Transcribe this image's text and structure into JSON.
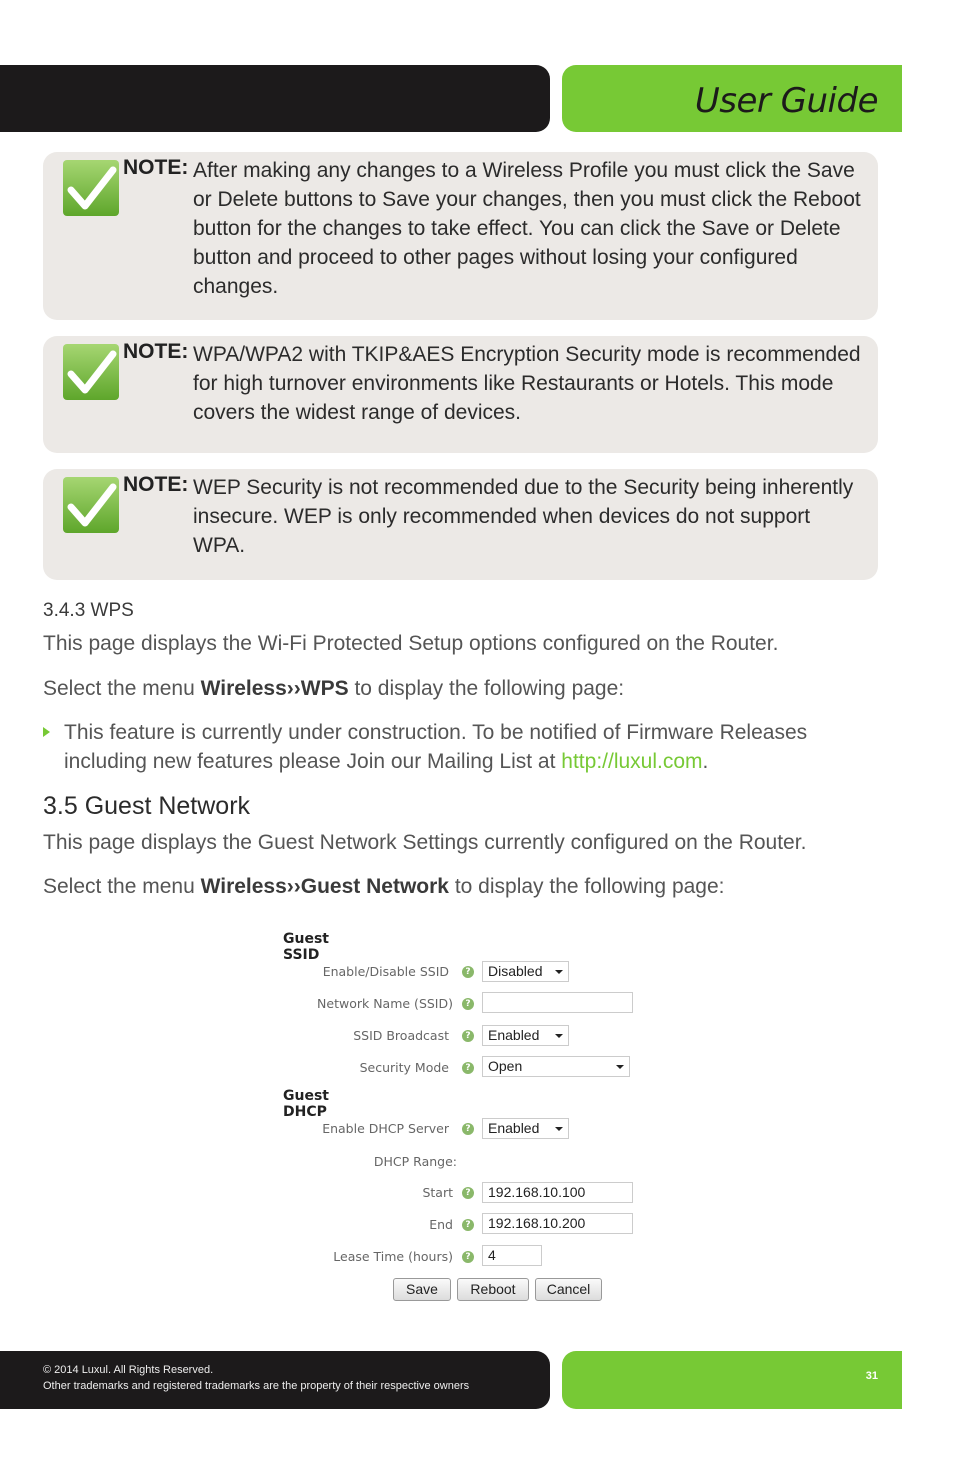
{
  "header": {
    "title": "User Guide"
  },
  "notes": [
    {
      "label": "NOTE:",
      "text": "After making any changes to a Wireless Profile you must click the Save or Delete buttons to Save your changes, then you must click the Reboot button for the changes to take effect. You can click the Save or Delete button and proceed to other pages without losing your configured changes."
    },
    {
      "label": "NOTE:",
      "text": " WPA/WPA2 with TKIP&AES Encryption Security mode is recommended for high turnover environments like Restaurants or Hotels. This mode covers the widest range of devices."
    },
    {
      "label": "NOTE:",
      "text": "WEP Security is not recommended due to the Security being inherently insecure. WEP is only recommended when devices do not support WPA."
    }
  ],
  "wps": {
    "heading": "3.4.3 WPS",
    "desc": "This page displays the Wi-Fi Protected Setup options configured on the Router.",
    "select_prefix": "Select the menu ",
    "select_menu": "Wireless››WPS",
    "select_suffix": " to display the following page:",
    "bullet_text": "This feature is currently under construction. To be notified of Firmware Releases including new features please Join our Mailing List at ",
    "bullet_link": "http://luxul.com",
    "bullet_end": "."
  },
  "guest": {
    "heading": "3.5 Guest Network",
    "desc": "This page displays the Guest Network Settings currently configured on the Router.",
    "select_prefix": "Select the menu ",
    "select_menu": "Wireless››Guest Network",
    "select_suffix": " to display the following page:"
  },
  "form": {
    "ssid_section": "Guest SSID",
    "enable_ssid_label": "Enable/Disable SSID",
    "enable_ssid_value": "Disabled",
    "network_name_label": "Network Name (SSID)",
    "network_name_value": "",
    "broadcast_label": "SSID Broadcast",
    "broadcast_value": "Enabled",
    "security_label": "Security Mode",
    "security_value": "Open",
    "dhcp_section": "Guest DHCP",
    "dhcp_server_label": "Enable DHCP Server",
    "dhcp_server_value": "Enabled",
    "dhcp_range_label": "DHCP Range:",
    "start_label": "Start",
    "start_value": "192.168.10.100",
    "end_label": "End",
    "end_value": "192.168.10.200",
    "lease_label": "Lease Time (hours)",
    "lease_value": "4",
    "help_glyph": "?",
    "save_label": "Save",
    "reboot_label": "Reboot",
    "cancel_label": "Cancel"
  },
  "footer": {
    "copyright": "© 2014  Luxul. All Rights Reserved.",
    "trademarks": "Other trademarks and registered trademarks are the property of their respective owners",
    "page_number": "31"
  }
}
